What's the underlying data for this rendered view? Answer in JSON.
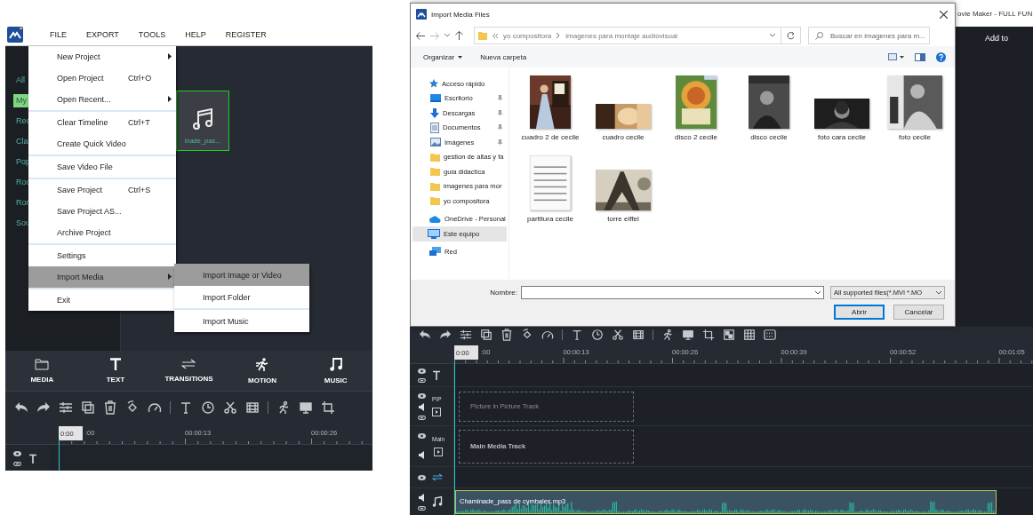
{
  "left_app": {
    "menu_bar": [
      {
        "label": "FILE"
      },
      {
        "label": "EXPORT"
      },
      {
        "label": "TOOLS"
      },
      {
        "label": "HELP"
      },
      {
        "label": "REGISTER"
      }
    ],
    "sidebar": {
      "items": [
        {
          "label": "All",
          "selected": false
        },
        {
          "label": "My",
          "selected": true
        },
        {
          "label": "Rec",
          "selected": false
        },
        {
          "label": "Cla",
          "selected": false
        },
        {
          "label": "Pop",
          "selected": false
        },
        {
          "label": "Roc",
          "selected": false
        },
        {
          "label": "Ror",
          "selected": false
        },
        {
          "label": "Sou",
          "selected": false
        }
      ]
    },
    "media_tile": {
      "label": "inade_pas...",
      "selected": true
    },
    "file_menu": {
      "groups": [
        [
          {
            "label": "New Project",
            "submenu": true,
            "selected": false
          },
          {
            "label": "Open Project",
            "shortcut": "Ctrl+O",
            "submenu": false,
            "selected": false
          },
          {
            "label": "Open Recent...",
            "submenu": true,
            "selected": false
          }
        ],
        [
          {
            "label": "Clear Timeline",
            "shortcut": "Ctrl+T",
            "submenu": false,
            "selected": false
          },
          {
            "label": "Create Quick Video",
            "submenu": false,
            "selected": false
          }
        ],
        [
          {
            "label": "Save Video File",
            "submenu": false,
            "selected": false
          }
        ],
        [
          {
            "label": "Save Project",
            "shortcut": "Ctrl+S",
            "submenu": false,
            "selected": false
          },
          {
            "label": "Save Project AS...",
            "submenu": false,
            "selected": false
          },
          {
            "label": "Archive Project",
            "submenu": false,
            "selected": false
          }
        ],
        [
          {
            "label": "Settings",
            "submenu": false,
            "selected": false
          },
          {
            "label": "Import Media",
            "submenu": true,
            "selected": true
          }
        ],
        [
          {
            "label": "Exit",
            "submenu": false,
            "selected": false
          }
        ]
      ]
    },
    "submenu": {
      "groups": [
        [
          {
            "label": "Import Image or Video",
            "selected": true
          },
          {
            "label": "Import Folder",
            "selected": false
          }
        ],
        [
          {
            "label": "Import Music",
            "selected": false
          }
        ]
      ]
    },
    "tabs": [
      {
        "label": "MEDIA",
        "kind": "media"
      },
      {
        "label": "TEXT",
        "kind": "text"
      },
      {
        "label": "TRANSITIONS",
        "kind": "transitions"
      },
      {
        "label": "MOTION",
        "kind": "motion"
      },
      {
        "label": "MUSIC",
        "kind": "music"
      }
    ],
    "timeline": {
      "playhead": "0:00",
      "ruler": [
        ":00",
        "00:00:13",
        "00:00:26"
      ],
      "tracks": [
        {
          "kind": "text"
        }
      ]
    }
  },
  "right_app": {
    "title": "ovie Maker - FULL FUN",
    "add_label": "Add to",
    "dialog": {
      "title": "Import Media Files",
      "path": [
        "yo compositora",
        "imagenes para montaje audiovisual"
      ],
      "search": {
        "placeholder": "Buscar en imagenes para m..."
      },
      "toolbar": [
        {
          "label": "Organizar",
          "kind": "menu"
        },
        {
          "label": "Nueva carpeta",
          "kind": "button"
        }
      ],
      "nav": [
        {
          "label": "Acceso rápido",
          "kind": "star",
          "selected": false,
          "children": [
            {
              "label": "Escritorio",
              "kind": "desktop",
              "pinned": true,
              "selected": false
            },
            {
              "label": "Descargas",
              "kind": "downloads",
              "pinned": true,
              "selected": false
            },
            {
              "label": "Documentos",
              "kind": "documents",
              "pinned": true,
              "selected": false
            },
            {
              "label": "Imágenes",
              "kind": "pictures",
              "pinned": true,
              "selected": false
            },
            {
              "label": "gestion de altas y fa",
              "kind": "folder",
              "pinned": false,
              "selected": false
            },
            {
              "label": "guia didactica",
              "kind": "folder",
              "pinned": false,
              "selected": false
            },
            {
              "label": "imagenes para mor",
              "kind": "folder",
              "pinned": false,
              "selected": false
            },
            {
              "label": "yo compositora",
              "kind": "folder",
              "pinned": false,
              "selected": false
            }
          ]
        },
        {
          "label": "OneDrive - Personal",
          "kind": "cloud",
          "selected": false
        },
        {
          "label": "Este equipo",
          "kind": "pc",
          "selected": true
        },
        {
          "label": "Red",
          "kind": "network",
          "selected": false
        }
      ],
      "files": [
        {
          "name": "cuadro 2 de cecile",
          "kind": "picture"
        },
        {
          "name": "cuadro cecile",
          "kind": "picture"
        },
        {
          "name": "disco 2 cecile",
          "kind": "picture"
        },
        {
          "name": "disco cecile",
          "kind": "picture"
        },
        {
          "name": "foto cara cecile",
          "kind": "picture"
        },
        {
          "name": "foto cecile",
          "kind": "picture"
        },
        {
          "name": "partitura cecile",
          "kind": "picture"
        },
        {
          "name": "torre eiffel",
          "kind": "picture"
        }
      ],
      "name_label": "Nombre:",
      "file_type": "All supported files(*.MVI *.MO",
      "buttons": [
        {
          "label": "Abrir",
          "default": true
        },
        {
          "label": "Cancelar",
          "default": false
        }
      ]
    },
    "timeline": {
      "playhead": "0:00",
      "ruler": [
        ":00",
        "00:00:13",
        "00:00:26",
        "00:00:39",
        "00:00:52",
        "00:01:05"
      ],
      "tracks": [
        {
          "kind": "text"
        },
        {
          "kind": "pip",
          "label": "PIP",
          "drop_hint": "Picture in Picture Track"
        },
        {
          "kind": "main",
          "label": "Main",
          "drop_hint": "Main Media Track"
        },
        {
          "kind": "transition"
        },
        {
          "kind": "music",
          "clip": "Chaminade_pass de cymbales.mp3"
        }
      ]
    }
  }
}
